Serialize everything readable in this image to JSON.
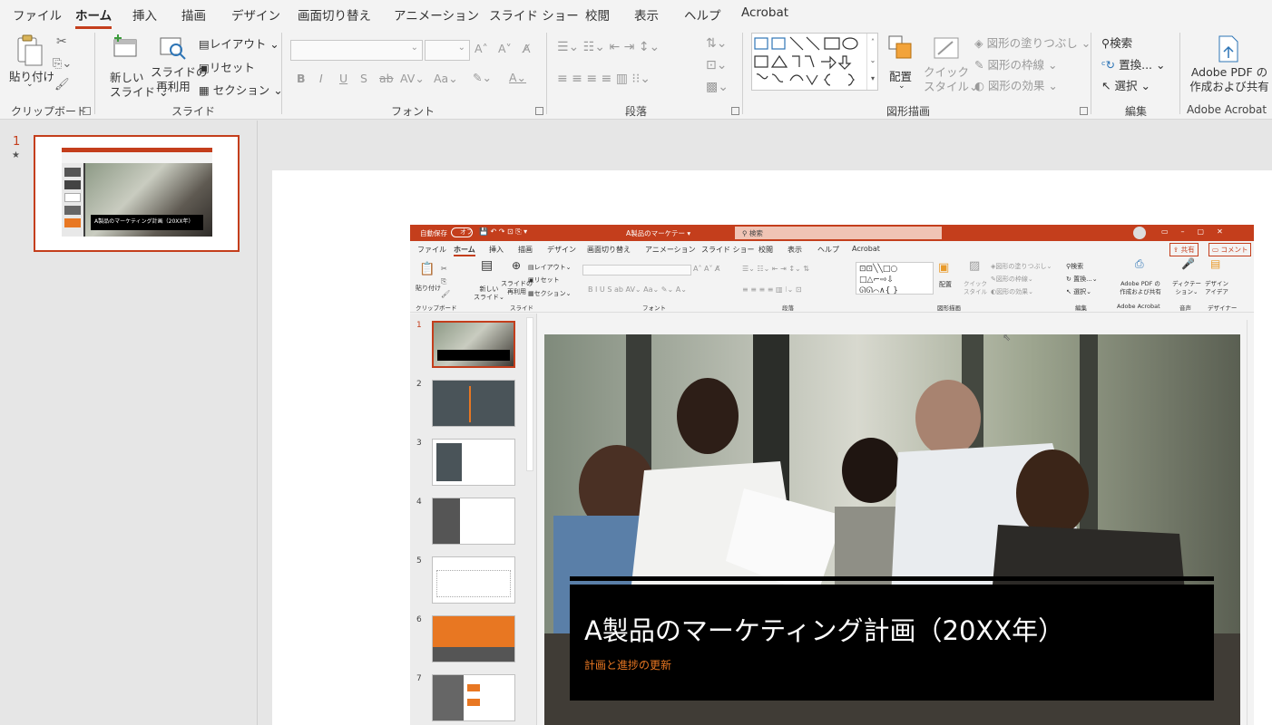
{
  "tabs": [
    "ファイル",
    "ホーム",
    "挿入",
    "描画",
    "デザイン",
    "画面切り替え",
    "アニメーション",
    "スライド ショー",
    "校閲",
    "表示",
    "ヘルプ",
    "Acrobat"
  ],
  "ribbon": {
    "paste": "貼り付け",
    "clipboard": "クリップボード",
    "new_slide": [
      "新しい",
      "スライド"
    ],
    "reuse": [
      "スライドの",
      "再利用"
    ],
    "layout": "レイアウト",
    "reset": "リセット",
    "section": "セクション",
    "slides_group": "スライド",
    "font_group": "フォント",
    "paragraph_group": "段落",
    "arrange": "配置",
    "quick_style": [
      "クイック",
      "スタイル"
    ],
    "shape_fill": "図形の塗りつぶし",
    "shape_outline": "図形の枠線",
    "shape_effects": "図形の効果",
    "drawing_group": "図形描画",
    "find": "検索",
    "replace": "置換...",
    "select": "選択",
    "editing_group": "編集",
    "adobe_pdf": [
      "Adobe PDF の",
      "作成および共有"
    ],
    "acrobat_group": "Adobe Acrobat",
    "font_buttons": [
      "B",
      "I",
      "U",
      "S",
      "ab",
      "AV",
      "Aa"
    ]
  },
  "thumb_main": {
    "num": "1",
    "title": "A製品のマーケティング計画（20XX年）"
  },
  "inner": {
    "autosave": "自動保存",
    "autosave_state": "オフ",
    "doc_title": "A製品のマーケテー",
    "search": "検索",
    "tabs": [
      "ファイル",
      "ホーム",
      "挿入",
      "描画",
      "デザイン",
      "画面切り替え",
      "アニメーション",
      "スライド ショー",
      "校閲",
      "表示",
      "ヘルプ",
      "Acrobat"
    ],
    "share": "共有",
    "comment": "コメント",
    "groups": [
      "クリップボード",
      "スライド",
      "フォント",
      "段落",
      "図形描画",
      "編集",
      "Adobe Acrobat",
      "音声",
      "デザイナー"
    ],
    "paste": "貼り付け",
    "new_slide": [
      "新しい",
      "スライド"
    ],
    "reuse": [
      "スライドの",
      "再利用"
    ],
    "layout": "レイアウト",
    "reset": "リセット",
    "section": "セクション",
    "arrange": "配置",
    "quick_style": [
      "クイック",
      "スタイル"
    ],
    "shape_fill": "図形の塗りつぶし",
    "shape_outline": "図形の枠線",
    "shape_effects": "図形の効果",
    "find": "検索",
    "replace": "置換...",
    "select": "選択",
    "adobe_pdf": [
      "Adobe PDF の",
      "作成および共有"
    ],
    "dictate": [
      "ディクテー",
      "ション"
    ],
    "designer": [
      "デザイン",
      "アイデア"
    ],
    "slide_numbers": [
      "1",
      "2",
      "3",
      "4",
      "5",
      "6",
      "7"
    ]
  },
  "slide": {
    "title": "A製品のマーケティング計画（20XX年）",
    "subtitle": "計画と進捗の更新"
  },
  "colors": {
    "accent": "#c43e1c",
    "orange": "#e87722",
    "bar": "#c43e1c"
  }
}
